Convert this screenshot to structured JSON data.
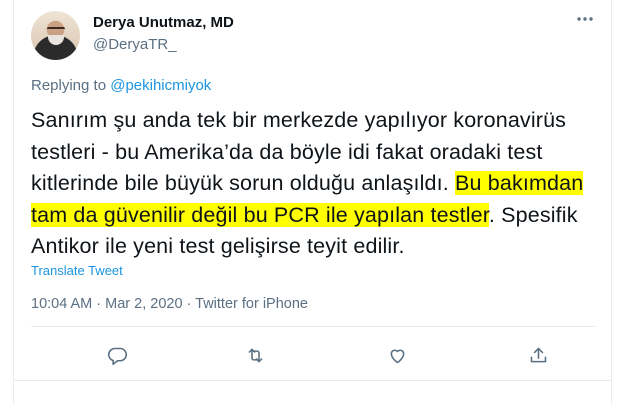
{
  "tweet": {
    "author_name": "Derya Unutmaz, MD",
    "author_handle": "@DeryaTR_",
    "replying_prefix": "Replying to ",
    "replying_to": "@pekihicmiyok",
    "text_before": "Sanırım şu anda tek bir merkezde yapılıyor koronavirüs testleri - bu Amerika’da da böyle idi fakat oradaki test kitlerinde bile büyük sorun olduğu anlaşıldı. ",
    "text_highlighted": "Bu bakımdan tam da güvenilir değil bu PCR ile yapılan testler",
    "text_after": ". Spesifik Antikor ile yeni test gelişirse teyit edilir.",
    "highlight_color": "#ffff00",
    "translate_label": "Translate Tweet",
    "timestamp": "10:04 AM · Mar 2, 2020 · Twitter for iPhone"
  },
  "icons": {
    "more": "more-icon",
    "reply": "reply-icon",
    "retweet": "retweet-icon",
    "like": "heart-icon",
    "share": "share-icon"
  },
  "colors": {
    "link": "#1b95e0",
    "secondary_text": "#5b7083",
    "primary_text": "#0f1419"
  }
}
